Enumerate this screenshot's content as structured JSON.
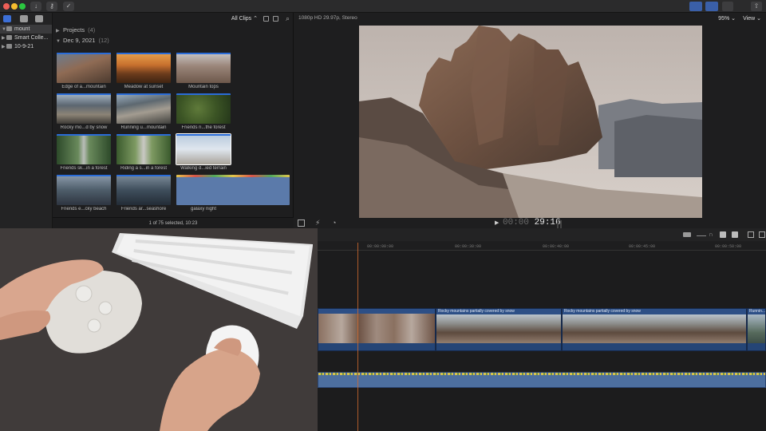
{
  "browser": {
    "filter_label": "All Clips",
    "projects_label": "Projects",
    "projects_count": "(4)",
    "event_date": "Dec 9, 2021",
    "event_count": "(12)",
    "clips": [
      {
        "label": "Edge of a...mountain"
      },
      {
        "label": "Meadow at sunset"
      },
      {
        "label": "Mountain tops"
      },
      {
        "label": "Rocky mo...d by snow"
      },
      {
        "label": "Running u...mountain"
      },
      {
        "label": "Friends ri...the forest"
      },
      {
        "label": "Friends sk...in a forest"
      },
      {
        "label": "Riding a s...in a forest"
      },
      {
        "label": "Walking d...ied terrain"
      },
      {
        "label": "Friends e...cky beach"
      },
      {
        "label": "Friends ar...seashore"
      },
      {
        "label": "galaxy night"
      }
    ],
    "status": "1 of 75 selected, 10:23"
  },
  "sidebar": {
    "items": [
      {
        "label": "mount"
      },
      {
        "label": "Smart Colle..."
      },
      {
        "label": "10-9-21"
      }
    ]
  },
  "viewer": {
    "format": "1080p HD 29.97p, Stereo",
    "zoom": "95%",
    "view_label": "View",
    "timecode_dim": "00:00",
    "timecode": "29:16"
  },
  "timeline": {
    "ticks": [
      "00:00:00:00",
      "00:00:30:00",
      "00:00:40:00",
      "00:00:45:00",
      "00:00:50:00"
    ],
    "clip_names": [
      "Rocky mountains partially covered by snow",
      "Rocky mountains partially covered by snow",
      "Runnin..."
    ]
  },
  "colors": {
    "accent": "#2f6bd8",
    "clip_blue": "#2d4f86",
    "playhead": "#d36b2e"
  }
}
